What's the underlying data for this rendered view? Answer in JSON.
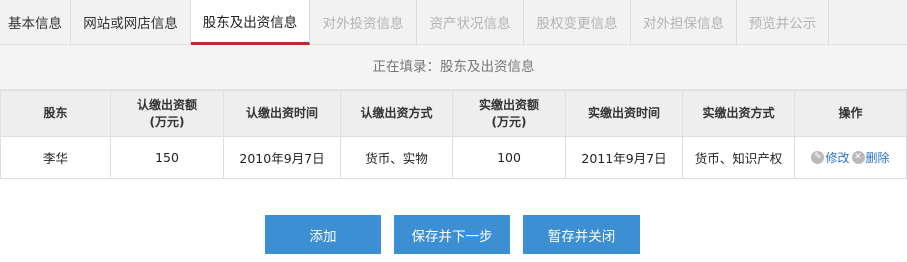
{
  "tabs": [
    {
      "label": "基本信息",
      "state": "normal"
    },
    {
      "label": "网站或网店信息",
      "state": "normal"
    },
    {
      "label": "股东及出资信息",
      "state": "active"
    },
    {
      "label": "对外投资信息",
      "state": "disabled"
    },
    {
      "label": "资产状况信息",
      "state": "disabled"
    },
    {
      "label": "股权变更信息",
      "state": "disabled"
    },
    {
      "label": "对外担保信息",
      "state": "disabled"
    },
    {
      "label": "预览并公示",
      "state": "disabled"
    }
  ],
  "banner": "正在填录：股东及出资信息",
  "table": {
    "headers": {
      "shareholder": "股东",
      "subscribed_amount_line1": "认缴出资额",
      "subscribed_amount_line2": "(万元)",
      "subscribed_time": "认缴出资时间",
      "subscribed_method": "认缴出资方式",
      "paid_amount_line1": "实缴出资额",
      "paid_amount_line2": "(万元)",
      "paid_time": "实缴出资时间",
      "paid_method": "实缴出资方式",
      "actions": "操作"
    },
    "rows": [
      {
        "shareholder": "李华",
        "subscribed_amount": "150",
        "subscribed_time": "2010年9月7日",
        "subscribed_method": "货币、实物",
        "paid_amount": "100",
        "paid_time": "2011年9月7日",
        "paid_method": "货币、知识产权",
        "edit_label": "修改",
        "delete_label": "删除"
      }
    ]
  },
  "buttons": {
    "add": "添加",
    "save_next": "保存并下一步",
    "save_close": "暂存并关闭"
  },
  "colors": {
    "active_tab_underline": "#c0262d",
    "button_bg": "#3d8fd4",
    "link": "#2a74c4",
    "disabled_tab_text": "#b3b3b3"
  }
}
